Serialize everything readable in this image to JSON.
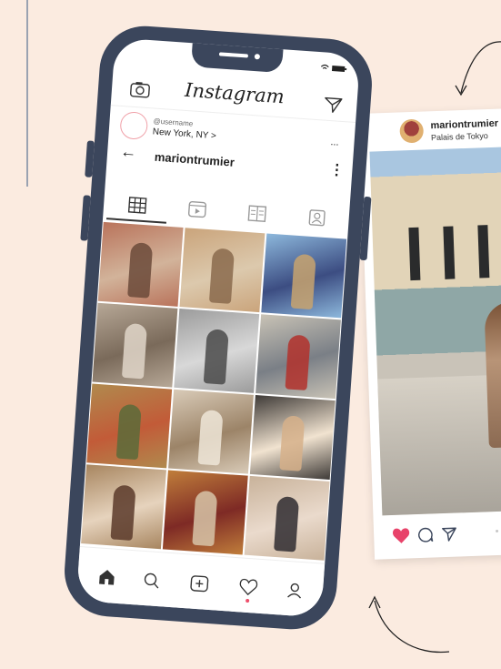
{
  "app": {
    "title": "Instagram"
  },
  "story": {
    "username": "@username",
    "location": "New York, NY",
    "location_chevron": ">"
  },
  "profile": {
    "name": "mariontrumier",
    "back": "←",
    "more": "⋮"
  },
  "header": {
    "more": "..."
  },
  "tabs": [
    {
      "icon": "grid-icon",
      "active": true
    },
    {
      "icon": "reels-icon",
      "active": false
    },
    {
      "icon": "guides-icon",
      "active": false
    },
    {
      "icon": "tagged-icon",
      "active": false
    }
  ],
  "grid": {
    "tiles": [
      {
        "colors": [
          "#b9735b",
          "#6b4a3a",
          "#d2b39a"
        ]
      },
      {
        "colors": [
          "#caa47b",
          "#8a6a4c",
          "#dcc9ad"
        ]
      },
      {
        "colors": [
          "#8db8dc",
          "#c8a36f",
          "#3c4d82"
        ]
      },
      {
        "colors": [
          "#b7a897",
          "#e0d6c9",
          "#7a6a5a"
        ]
      },
      {
        "colors": [
          "#9b9b9b",
          "#4a4a4a",
          "#d8d8d8"
        ]
      },
      {
        "colors": [
          "#c9c3b6",
          "#b3312c",
          "#7a7f86"
        ]
      },
      {
        "colors": [
          "#b08a4e",
          "#5b6b3a",
          "#c25b38"
        ]
      },
      {
        "colors": [
          "#d9cbb8",
          "#efe6d8",
          "#9c8468"
        ]
      },
      {
        "colors": [
          "#3e3a37",
          "#d6b08a",
          "#f1e3d0"
        ]
      },
      {
        "colors": [
          "#a7855f",
          "#5b3a2a",
          "#e6d3bd"
        ]
      },
      {
        "colors": [
          "#c07e3b",
          "#d7c4a8",
          "#7e2a25"
        ]
      },
      {
        "colors": [
          "#c8b29a",
          "#2f2b30",
          "#eadacc"
        ]
      }
    ]
  },
  "notification": {
    "comments": "1",
    "likes": "1",
    "follows": "1",
    "color": "#ee4e6a"
  },
  "bottom_nav": [
    "home-icon",
    "search-icon",
    "add-icon",
    "activity-icon",
    "profile-icon"
  ],
  "post": {
    "username": "mariontrumier",
    "location": "Palais de Tokyo",
    "liked": true,
    "like_color": "#e8436a"
  }
}
